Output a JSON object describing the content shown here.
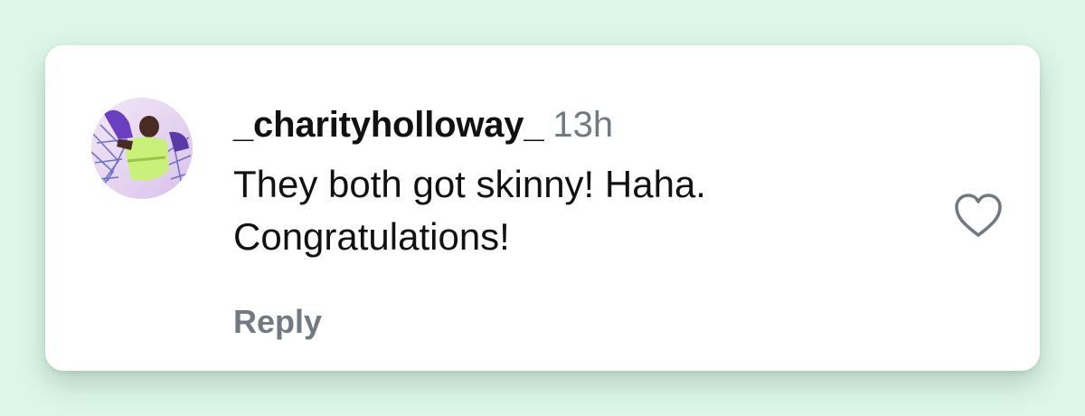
{
  "comment": {
    "username": "_charityholloway_",
    "timestamp": "13h",
    "text": "They both got skinny! Haha. Congratulations!",
    "reply_label": "Reply"
  },
  "icons": {
    "like": "heart-outline-icon",
    "avatar": "profile-photo"
  },
  "colors": {
    "background": "#dcf7e7",
    "card": "#ffffff",
    "text_primary": "#111111",
    "text_secondary": "#737980",
    "icon_stroke": "#737980"
  }
}
